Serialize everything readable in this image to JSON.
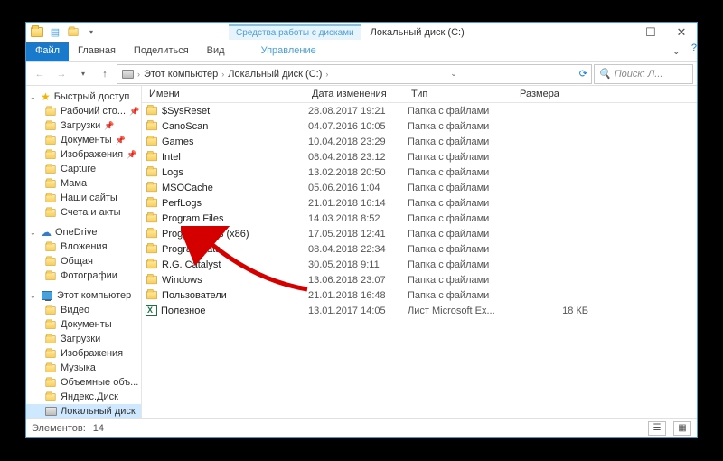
{
  "window": {
    "contextual_tab_group": "Средства работы с дисками",
    "title": "Локальный диск (C:)"
  },
  "ribbon": {
    "file": "Файл",
    "tabs": [
      "Главная",
      "Поделиться",
      "Вид"
    ],
    "ctx_tab": "Управление"
  },
  "address": {
    "crumbs": [
      "Этот компьютер",
      "Локальный диск (C:)"
    ]
  },
  "search": {
    "placeholder": "Поиск: Л..."
  },
  "sidebar": {
    "quick": {
      "label": "Быстрый доступ",
      "items": [
        "Рабочий сто...",
        "Загрузки",
        "Документы",
        "Изображения",
        "Capture",
        "Мама",
        "Наши сайты",
        "Счета и акты"
      ]
    },
    "onedrive": {
      "label": "OneDrive",
      "items": [
        "Вложения",
        "Общая",
        "Фотографии"
      ]
    },
    "thispc": {
      "label": "Этот компьютер",
      "items": [
        "Видео",
        "Документы",
        "Загрузки",
        "Изображения",
        "Музыка",
        "Объемные объ...",
        "Яндекс.Диск",
        "Локальный диск"
      ]
    }
  },
  "columns": {
    "name": "Имени",
    "date": "Дата изменения",
    "type": "Тип",
    "size": "Размера"
  },
  "files": [
    {
      "name": "$SysReset",
      "date": "28.08.2017 19:21",
      "type": "Папка с файлами",
      "size": "",
      "icon": "folder"
    },
    {
      "name": "CanoScan",
      "date": "04.07.2016 10:05",
      "type": "Папка с файлами",
      "size": "",
      "icon": "folder"
    },
    {
      "name": "Games",
      "date": "10.04.2018 23:29",
      "type": "Папка с файлами",
      "size": "",
      "icon": "folder"
    },
    {
      "name": "Intel",
      "date": "08.04.2018 23:12",
      "type": "Папка с файлами",
      "size": "",
      "icon": "folder"
    },
    {
      "name": "Logs",
      "date": "13.02.2018 20:50",
      "type": "Папка с файлами",
      "size": "",
      "icon": "folder"
    },
    {
      "name": "MSOCache",
      "date": "05.06.2016 1:04",
      "type": "Папка с файлами",
      "size": "",
      "icon": "folder"
    },
    {
      "name": "PerfLogs",
      "date": "21.01.2018 16:14",
      "type": "Папка с файлами",
      "size": "",
      "icon": "folder"
    },
    {
      "name": "Program Files",
      "date": "14.03.2018 8:52",
      "type": "Папка с файлами",
      "size": "",
      "icon": "folder"
    },
    {
      "name": "Program Files (x86)",
      "date": "17.05.2018 12:41",
      "type": "Папка с файлами",
      "size": "",
      "icon": "folder"
    },
    {
      "name": "ProgramData",
      "date": "08.04.2018 22:34",
      "type": "Папка с файлами",
      "size": "",
      "icon": "folder"
    },
    {
      "name": "R.G. Catalyst",
      "date": "30.05.2018 9:11",
      "type": "Папка с файлами",
      "size": "",
      "icon": "folder"
    },
    {
      "name": "Windows",
      "date": "13.06.2018 23:07",
      "type": "Папка с файлами",
      "size": "",
      "icon": "folder"
    },
    {
      "name": "Пользователи",
      "date": "21.01.2018 16:48",
      "type": "Папка с файлами",
      "size": "",
      "icon": "folder"
    },
    {
      "name": "Полезное",
      "date": "13.01.2017 14:05",
      "type": "Лист Microsoft Ex...",
      "size": "18 КБ",
      "icon": "excel"
    }
  ],
  "status": {
    "count_label": "Элементов:",
    "count": "14"
  }
}
